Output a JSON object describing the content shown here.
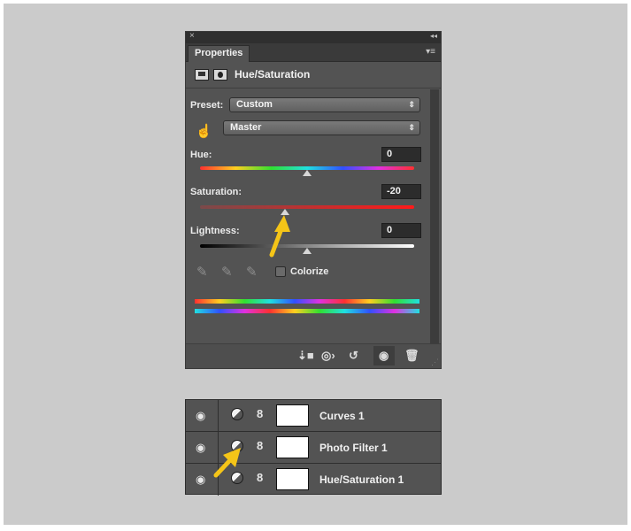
{
  "properties_panel": {
    "window_close": "×",
    "collapse": "◂◂",
    "tab_label": "Properties",
    "panel_menu": "▾≡",
    "title": "Hue/Saturation",
    "preset_label": "Preset:",
    "preset_value": "Custom",
    "channel_value": "Master",
    "hue_label": "Hue:",
    "hue_value": "0",
    "saturation_label": "Saturation:",
    "saturation_value": "-20",
    "lightness_label": "Lightness:",
    "lightness_value": "0",
    "colorize_label": "Colorize",
    "colorize_checked": false
  },
  "layers_panel": {
    "layers": [
      {
        "name": "Curves 1"
      },
      {
        "name": "Photo Filter 1"
      },
      {
        "name": "Hue/Saturation 1"
      }
    ]
  },
  "colors": {
    "background": "#cbcbcb",
    "panel": "#535353",
    "annotation_arrow": "#f5c518"
  },
  "icons": [
    "close-icon",
    "collapse-icon",
    "panel-menu-icon",
    "adjustment-layer-icon",
    "mask-icon",
    "targeted-adjust-hand-icon",
    "eyedropper-icon",
    "eyedropper-plus-icon",
    "eyedropper-minus-icon",
    "clip-to-layer-icon",
    "view-previous-icon",
    "reset-icon",
    "visibility-eye-icon",
    "trash-icon",
    "link-chain-icon"
  ]
}
